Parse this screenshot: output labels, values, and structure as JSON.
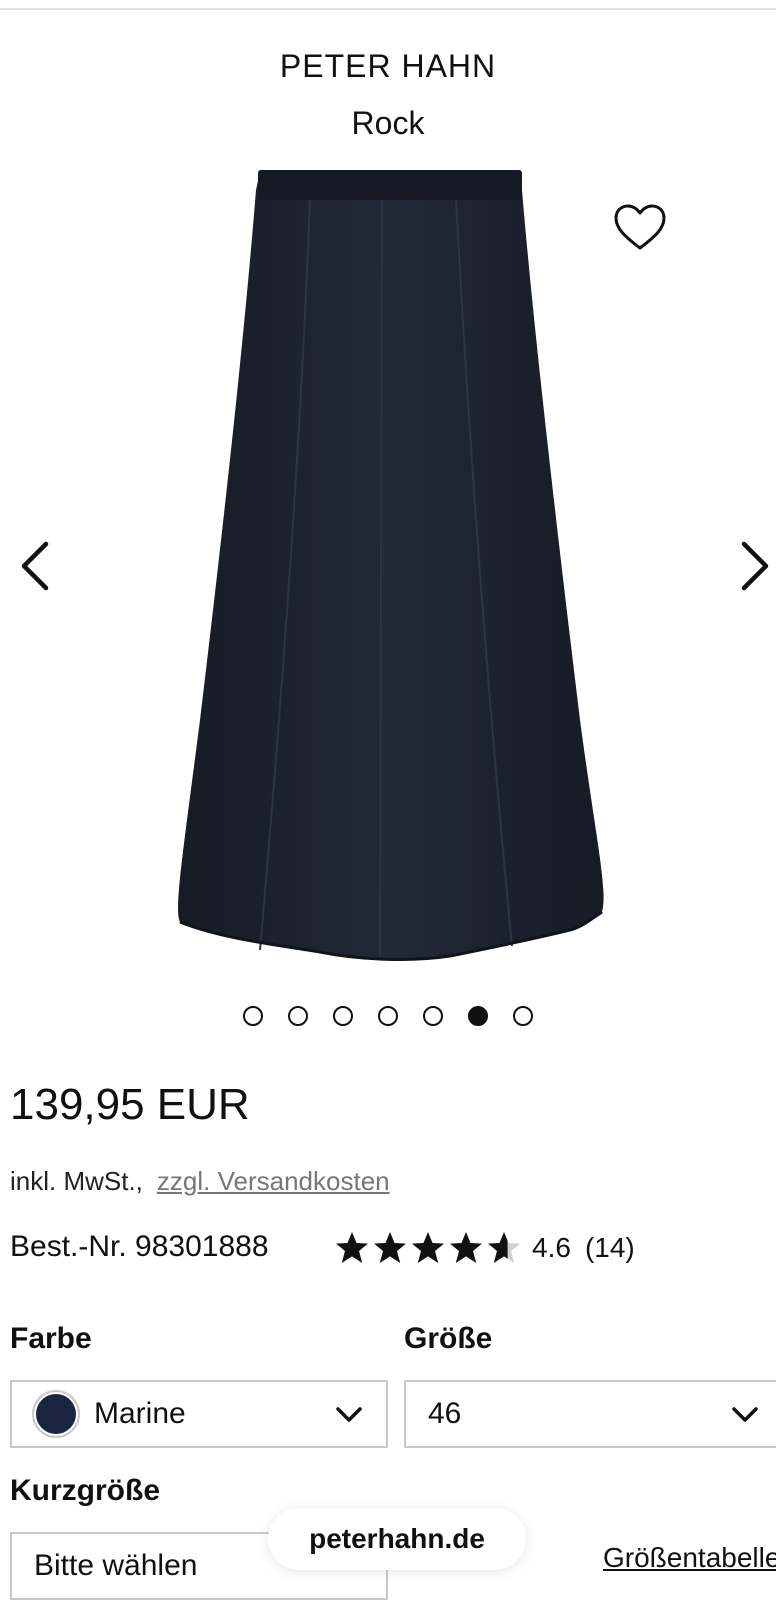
{
  "product": {
    "brand": "PETER HAHN",
    "name": "Rock",
    "image_alt": "Rock",
    "image_color": "#1c222d"
  },
  "gallery": {
    "dot_count": 7,
    "active_index": 5
  },
  "price": {
    "amount": "139,95 EUR",
    "tax_note": "inkl. MwSt.,",
    "shipping_link": "zzgl. Versandkosten"
  },
  "order": {
    "number": "Best.-Nr. 98301888"
  },
  "rating": {
    "stars": 4.6,
    "max_stars": 5,
    "value": "4.6",
    "count": "(14)"
  },
  "options": {
    "color_label": "Farbe",
    "color_value": "Marine",
    "color_swatch": "#1a2340",
    "size_label": "Größe",
    "size_value": "46",
    "short_label": "Kurzgröße",
    "short_value": "Bitte wählen",
    "size_chart_link": "Größentabelle"
  },
  "browser": {
    "domain": "peterhahn.de"
  },
  "icons": {
    "wishlist": "heart-outline-icon",
    "prev": "chevron-left-icon",
    "next": "chevron-right-icon",
    "dropdown": "chevron-down-icon",
    "star": "star-icon"
  }
}
